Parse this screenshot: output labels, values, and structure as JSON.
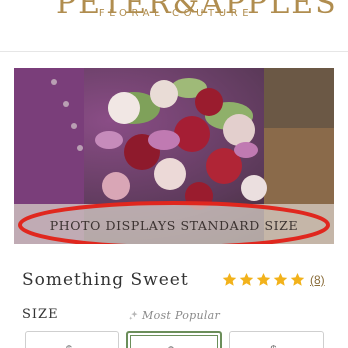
{
  "header": {
    "logo_text": "PETER&APPLES",
    "logo_tagline": "FLORAL COUTURE",
    "menu_icon": "hamburger-menu-icon"
  },
  "product": {
    "image_disclaimer": "PHOTO DISPLAYS STANDARD SIZE",
    "name": "Something Sweet",
    "rating": 5,
    "rating_max": 5,
    "review_count": "(8)"
  },
  "size": {
    "label": "SIZE",
    "popular_label": "Most Popular",
    "popular_icon": "sparkle-icon",
    "options": [
      {
        "price": "$..",
        "selected": false
      },
      {
        "price": "$..",
        "selected": true
      },
      {
        "price": "$..",
        "selected": false
      }
    ]
  },
  "colors": {
    "brand_gold": "#b08d4f",
    "star": "#f2b21b",
    "selected_border": "#6b8e5a",
    "annotation_red": "#e0271e"
  }
}
